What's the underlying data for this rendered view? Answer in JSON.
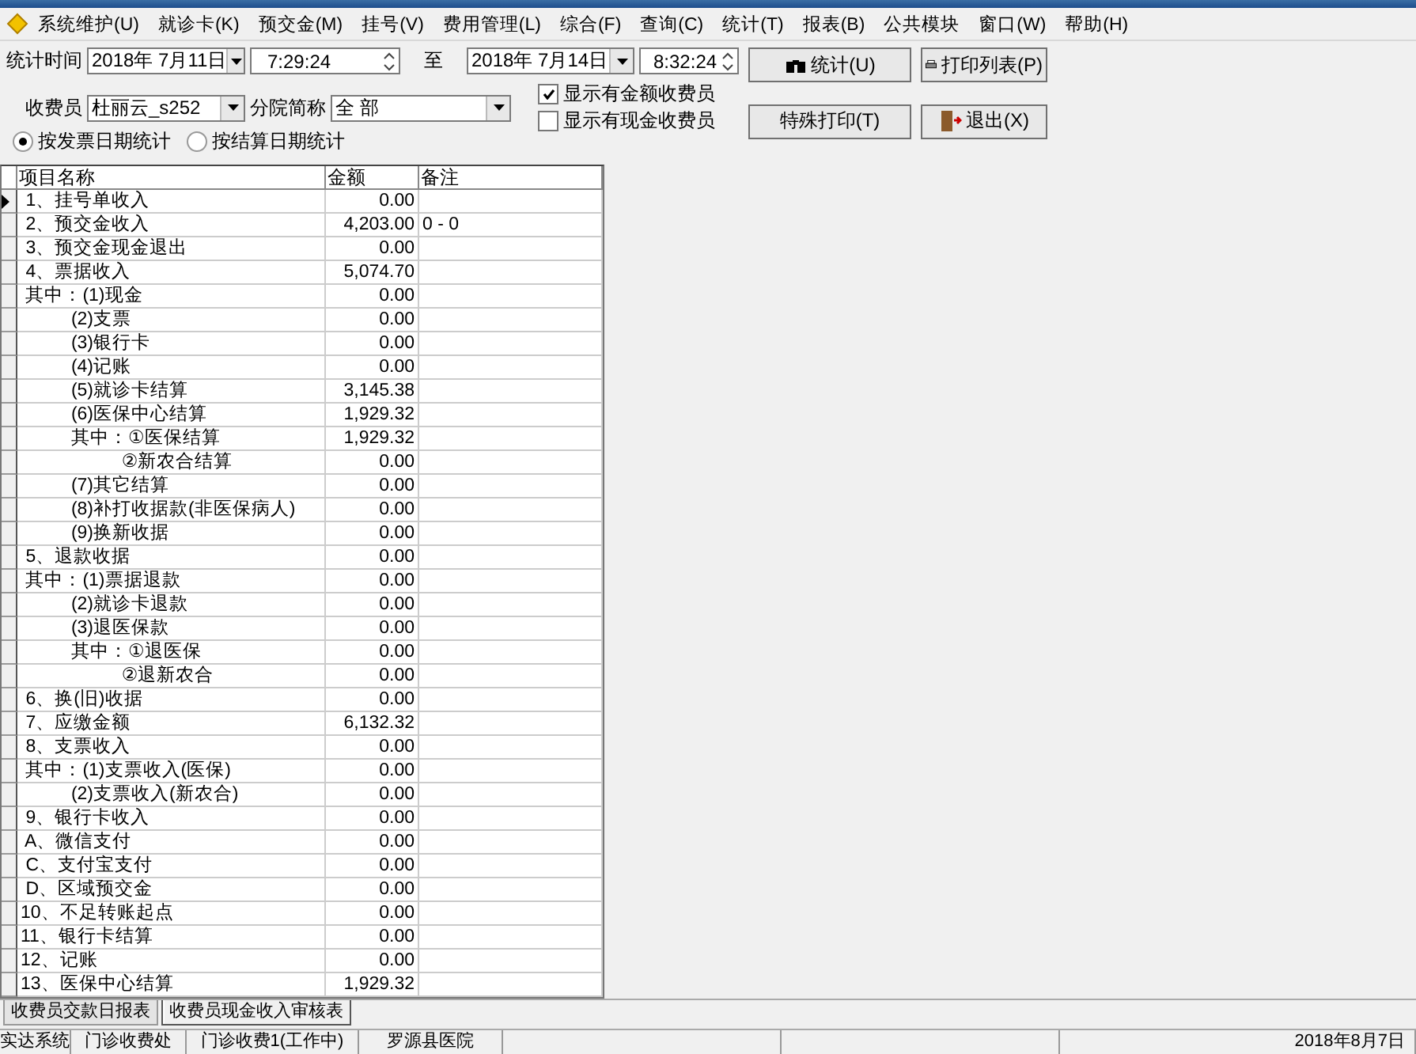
{
  "menu": [
    "系统维护(U)",
    "就诊卡(K)",
    "预交金(M)",
    "挂号(V)",
    "费用管理(L)",
    "综合(F)",
    "查询(C)",
    "统计(T)",
    "报表(B)",
    "公共模块",
    "窗口(W)",
    "帮助(H)"
  ],
  "filters": {
    "time_label": "统计时间",
    "start_date": "2018年 7月11日",
    "start_time": "7:29:24",
    "to_label": "至",
    "end_date": "2018年 7月14日",
    "end_time": "8:32:24",
    "cashier_label": "收费员",
    "cashier": "杜丽云_s252",
    "branch_label": "分院简称",
    "branch": "全 部",
    "checkboxes": [
      {
        "label": "显示有金额收费员",
        "checked": true
      },
      {
        "label": "显示有现金收费员",
        "checked": false
      }
    ],
    "radios": [
      {
        "label": "按发票日期统计",
        "selected": true
      },
      {
        "label": "按结算日期统计",
        "selected": false
      }
    ]
  },
  "buttons": [
    {
      "kind": "stats",
      "label": "统计(U)"
    },
    {
      "kind": "print",
      "label": "打印列表(P)"
    },
    {
      "kind": "plain",
      "label": "特殊打印(T)"
    },
    {
      "kind": "exit",
      "label": "退出(X)"
    }
  ],
  "table": {
    "columns": [
      "项目名称",
      "金额",
      "备注"
    ],
    "rows": [
      {
        "name": " 1、挂号单收入",
        "amount": "0.00",
        "note": "",
        "selected": true
      },
      {
        "name": " 2、预交金收入",
        "amount": "4,203.00",
        "note": "0 - 0",
        "selected": false
      },
      {
        "name": " 3、预交金现金退出",
        "amount": "0.00",
        "note": "",
        "selected": false
      },
      {
        "name": " 4、票据收入",
        "amount": "5,074.70",
        "note": "",
        "selected": false
      },
      {
        "name": " 其中：(1)现金",
        "amount": "0.00",
        "note": "",
        "selected": false
      },
      {
        "name": "          (2)支票",
        "amount": "0.00",
        "note": "",
        "selected": false
      },
      {
        "name": "          (3)银行卡",
        "amount": "0.00",
        "note": "",
        "selected": false
      },
      {
        "name": "          (4)记账",
        "amount": "0.00",
        "note": "",
        "selected": false
      },
      {
        "name": "          (5)就诊卡结算",
        "amount": "3,145.38",
        "note": "",
        "selected": false
      },
      {
        "name": "          (6)医保中心结算",
        "amount": "1,929.32",
        "note": "",
        "selected": false
      },
      {
        "name": "          其中：①医保结算",
        "amount": "1,929.32",
        "note": "",
        "selected": false
      },
      {
        "name": "                    ②新农合结算",
        "amount": "0.00",
        "note": "",
        "selected": false
      },
      {
        "name": "          (7)其它结算",
        "amount": "0.00",
        "note": "",
        "selected": false
      },
      {
        "name": "          (8)补打收据款(非医保病人)",
        "amount": "0.00",
        "note": "",
        "selected": false
      },
      {
        "name": "          (9)换新收据",
        "amount": "0.00",
        "note": "",
        "selected": false
      },
      {
        "name": " 5、退款收据",
        "amount": "0.00",
        "note": "",
        "selected": false
      },
      {
        "name": " 其中：(1)票据退款",
        "amount": "0.00",
        "note": "",
        "selected": false
      },
      {
        "name": "          (2)就诊卡退款",
        "amount": "0.00",
        "note": "",
        "selected": false
      },
      {
        "name": "          (3)退医保款",
        "amount": "0.00",
        "note": "",
        "selected": false
      },
      {
        "name": "          其中：①退医保",
        "amount": "0.00",
        "note": "",
        "selected": false
      },
      {
        "name": "                    ②退新农合",
        "amount": "0.00",
        "note": "",
        "selected": false
      },
      {
        "name": " 6、换(旧)收据",
        "amount": "0.00",
        "note": "",
        "selected": false
      },
      {
        "name": " 7、应缴金额",
        "amount": "6,132.32",
        "note": "",
        "selected": false
      },
      {
        "name": " 8、支票收入",
        "amount": "0.00",
        "note": "",
        "selected": false
      },
      {
        "name": " 其中：(1)支票收入(医保)",
        "amount": "0.00",
        "note": "",
        "selected": false
      },
      {
        "name": "          (2)支票收入(新农合)",
        "amount": "0.00",
        "note": "",
        "selected": false
      },
      {
        "name": " 9、银行卡收入",
        "amount": "0.00",
        "note": "",
        "selected": false
      },
      {
        "name": " A、微信支付",
        "amount": "0.00",
        "note": "",
        "selected": false
      },
      {
        "name": " C、支付宝支付",
        "amount": "0.00",
        "note": "",
        "selected": false
      },
      {
        "name": " D、区域预交金",
        "amount": "0.00",
        "note": "",
        "selected": false
      },
      {
        "name": "10、不足转账起点",
        "amount": "0.00",
        "note": "",
        "selected": false
      },
      {
        "name": "11、银行卡结算",
        "amount": "0.00",
        "note": "",
        "selected": false
      },
      {
        "name": "12、记账",
        "amount": "0.00",
        "note": "",
        "selected": false
      },
      {
        "name": "13、医保中心结算",
        "amount": "1,929.32",
        "note": "",
        "selected": false
      }
    ]
  },
  "tabs": [
    {
      "label": "收费员交款日报表",
      "selected": false
    },
    {
      "label": "收费员现金收入审核表",
      "selected": true
    }
  ],
  "status_bar": [
    "实达系统",
    "门诊收费处",
    "门诊收费1(工作中)",
    "罗源县医院",
    "2018年8月7日"
  ]
}
